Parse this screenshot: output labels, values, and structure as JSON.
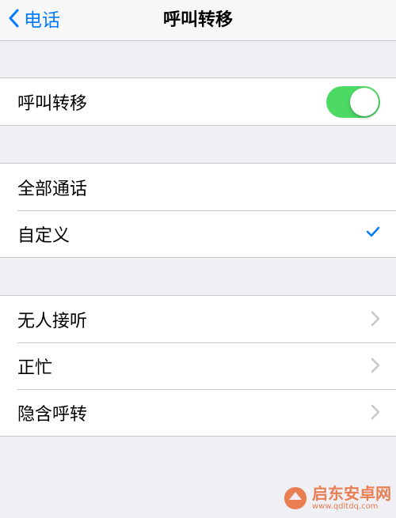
{
  "navbar": {
    "back_label": "电话",
    "title": "呼叫转移"
  },
  "forwarding": {
    "label": "呼叫转移",
    "enabled": true,
    "accent_color": "#4cd964"
  },
  "scope": {
    "items": [
      {
        "label": "全部通话",
        "selected": false
      },
      {
        "label": "自定义",
        "selected": true
      }
    ]
  },
  "conditions": {
    "items": [
      {
        "label": "无人接听",
        "icon": "chevron-right-icon"
      },
      {
        "label": "正忙",
        "icon": "chevron-right-icon"
      },
      {
        "label": "隐含呼转",
        "icon": "chevron-right-icon"
      }
    ]
  },
  "watermark": {
    "brand": "启东安卓网",
    "url": "www.qdltdq.com"
  },
  "colors": {
    "tint": "#007aff",
    "background": "#efeff4",
    "watermark": "#e8622c"
  }
}
